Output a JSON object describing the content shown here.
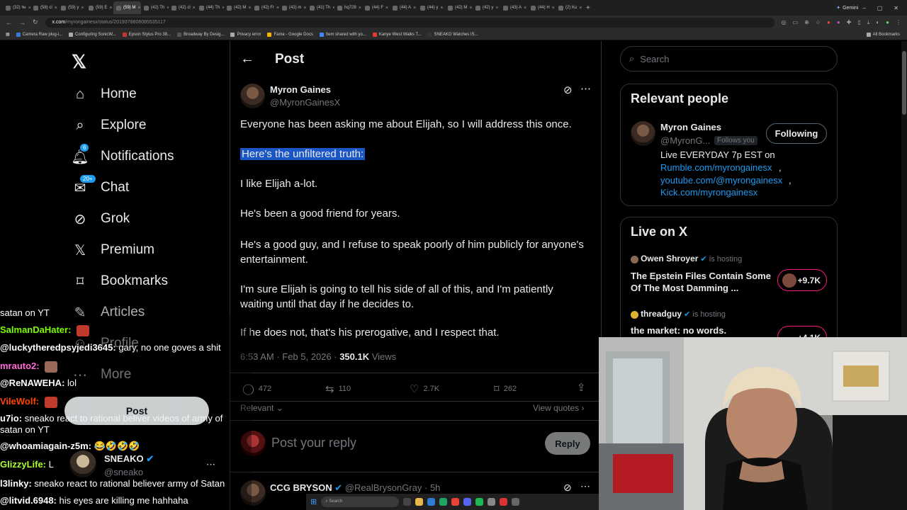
{
  "browser": {
    "tabs": [
      "(32) №",
      "(58) cl",
      "(59) y",
      "(59) E",
      "(59) M",
      "(42) Th",
      "(42) cl",
      "(44) Th",
      "(42) M",
      "(42) Fr",
      "(42) m",
      "(41) Th",
      "hq728",
      "(44) F",
      "(44) A",
      "(44) y",
      "(42) M",
      "(42) y",
      "(43) A",
      "(44) H",
      "(2) Ku"
    ],
    "active_tab_index": 4,
    "gemini_label": "Gemini",
    "url_host": "x.com",
    "url_path": "/myrongainesx/status/2019378806085535117",
    "bookmarks": [
      "Camera Raw plug-i...",
      "Configuring SonicW...",
      "Epson Stylus Pro 38...",
      "Broadway By Desig...",
      "Privacy error",
      "Fame - Google Docs",
      "Item shared with yo...",
      "Kanye West Walks T...",
      "SNEAKO Watches IS..."
    ],
    "all_bookmarks": "All Bookmarks"
  },
  "nav": {
    "items": [
      {
        "label": "Home",
        "icon": "home-icon"
      },
      {
        "label": "Explore",
        "icon": "search-icon"
      },
      {
        "label": "Notifications",
        "icon": "bell-icon",
        "badge": "6"
      },
      {
        "label": "Chat",
        "icon": "chat-icon",
        "badge": "20+"
      },
      {
        "label": "Grok",
        "icon": "grok-icon"
      },
      {
        "label": "Premium",
        "icon": "x-icon"
      },
      {
        "label": "Bookmarks",
        "icon": "bookmark-icon"
      },
      {
        "label": "Articles",
        "icon": "articles-icon"
      },
      {
        "label": "Profile",
        "icon": "profile-icon"
      },
      {
        "label": "More",
        "icon": "more-icon"
      }
    ],
    "post_button": "Post",
    "account": {
      "name": "SNEAKO",
      "handle": "@sneako"
    }
  },
  "post": {
    "header": "Post",
    "author": {
      "name": "Myron Gaines",
      "handle": "@MyronGainesX"
    },
    "paragraphs": [
      "Everyone has been asking me about Elijah, so I will address this once.",
      "Here's the unfiltered truth:",
      "I like Elijah a-lot.",
      "He's been a good friend for years.",
      "He's a good guy, and I refuse to speak poorly of him publicly for anyone's entertainment.",
      "I'm sure Elijah is going to tell his side of all of this, and I'm patiently waiting until that day if he decides to.",
      "If he does not, that's his prerogative, and I respect that."
    ],
    "timestamp": "6:53 AM · Feb 5, 2026 · ",
    "views_count": "350.1K",
    "views_label": " Views",
    "stats": {
      "replies": "472",
      "reposts": "110",
      "likes": "2.7K",
      "bookmarks": "262"
    },
    "sort_label": "Relevant",
    "view_quotes": "View quotes",
    "reply_placeholder": "Post your reply",
    "reply_button": "Reply",
    "next_reply": {
      "name": "CCG BRYSON",
      "handle": "@RealBrysonGray",
      "time": "· 5h"
    }
  },
  "right": {
    "search_placeholder": "Search",
    "relevant_title": "Relevant people",
    "person": {
      "name": "Myron Gaines",
      "handle": "@MyronG...",
      "follows_you": "Follows you",
      "button": "Following",
      "bio": "Live EVERYDAY 7p EST on",
      "links": [
        "Rumble.com/myrongainesx",
        "youtube.com/@myrongainesx",
        "Kick.com/myrongainesx"
      ]
    },
    "live_title": "Live on X",
    "live": [
      {
        "host": "Owen Shroyer",
        "hosting": "is hosting",
        "title": "The Epstein Files Contain Some Of The Most Damming ...",
        "count": "+9.7K"
      },
      {
        "host": "threadguy",
        "hosting": "is hosting",
        "title": "the market: no words.",
        "count": "+4.1K"
      }
    ]
  },
  "chat": [
    {
      "user": "",
      "text": "satan on YT"
    },
    {
      "user": "SalmanDaHater:",
      "text": "",
      "color": "#7cfc00"
    },
    {
      "user": "@luckytheredpsyjedi3645:",
      "text": "gary, no one goves a shit",
      "color": "#ffffff"
    },
    {
      "user": "mrauto2:",
      "text": "",
      "color": "#ff69d9"
    },
    {
      "user": "@ReNAWEHA:",
      "text": "lol",
      "color": "#ffffff"
    },
    {
      "user": "VileWolf:",
      "text": "",
      "color": "#ff4500"
    },
    {
      "user": "u7io:",
      "text": "sneako react to rational beliver videos of army of",
      "color": "#ffffff"
    },
    {
      "user": "",
      "text": "satan on YT"
    },
    {
      "user": "@whoamiagain-z5m:",
      "text": "😂🤣🤣🤣",
      "color": "#ffffff"
    },
    {
      "user": "GlizzyLife:",
      "text": "L",
      "color": "#adff2f"
    },
    {
      "user": "l3linky:",
      "text": "sneako react to rational believer army of Satan",
      "color": "#ffffff"
    },
    {
      "user": "@litvid.6948:",
      "text": "his eyes are killing me hahhaha",
      "color": "#ffffff"
    }
  ],
  "colors": {
    "accent": "#1d9bf0",
    "bg": "#000000",
    "border": "#2f3336",
    "live": "#f91880"
  }
}
